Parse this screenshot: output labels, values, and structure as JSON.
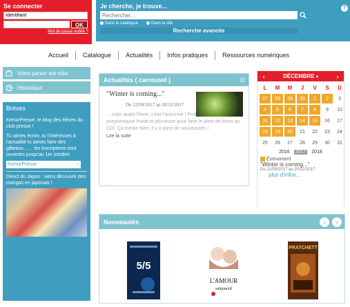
{
  "login": {
    "title": "Se connecter",
    "username_value": "Identifiant",
    "password_value": "",
    "ok_label": "OK",
    "forgot_label": "Mot de passe oublié ?"
  },
  "search": {
    "title": "Je cherche, je trouve...",
    "placeholder": "Rechercher...",
    "radio_catalogue": "Dans le catalogue",
    "radio_site": "Dans le site",
    "advanced_label": "Recherche avancée",
    "help_label": "?"
  },
  "nav": {
    "items": [
      "Accueil",
      "Catalogue",
      "Actualités",
      "Infos pratiques",
      "Ressources numériques"
    ]
  },
  "sidebar": {
    "cart_label": "Votre panier est vide.",
    "history_label": "Historique"
  },
  "breves": {
    "title": "Brèves",
    "p1": "Kerva'Presse, le blog des élèves du club presse !",
    "p2": "Tu aimes écrire, tu t'intéresses à l'actualité tu aimes faire des gâteaux... ... les inscriptions sont ouvertes jusqu'au 1er octobre",
    "button_label": "Kerva'Presse",
    "p3": "Direct du Japon : viens découvrir des mangas en japonais !"
  },
  "actualites": {
    "title": "Actualités ( carrousel )",
    "article_title": "\"Winter is coming...\"",
    "date_text": "Du 22/09/2017 au 20/12/2017",
    "excerpt": "... mais avant l'hiver, c'est l'automne ! Profite de la météo aveyronnaise froide et pluvieuse pour faire le plein de livres au CDI. Ça tombe bien, il y a plein de nouveautés !",
    "more_label": "Lire la suite"
  },
  "calendar": {
    "month": "DÉCEMBRE",
    "weekdays": [
      "L",
      "M",
      "M",
      "J",
      "V",
      "S",
      "D"
    ],
    "days": [
      "27",
      "28",
      "29",
      "30",
      "1",
      "2",
      "3",
      "4",
      "5",
      "6",
      "7",
      "8",
      "9",
      "10",
      "11",
      "12",
      "13",
      "14",
      "15",
      "16",
      "17",
      "18",
      "19",
      "20",
      "21",
      "22",
      "23",
      "24",
      "25",
      "26",
      "27",
      "28",
      "29",
      "30",
      "31"
    ],
    "event_days": [
      "27",
      "28",
      "29",
      "30",
      "1",
      "2",
      "4",
      "5",
      "6",
      "7",
      "8",
      "11",
      "12",
      "13",
      "14",
      "15",
      "18",
      "19",
      "20"
    ],
    "years": [
      "2016",
      "2017",
      "2018"
    ],
    "current_year": "2017",
    "legend_label": "Événement",
    "event_title": "\"Winter is coming...\"",
    "event_dates": "Du 22/09/2017 au 20/12/2017",
    "more_label": "plus d'infos..."
  },
  "nouveautes": {
    "title": "Nouveautés"
  },
  "colors": {
    "red": "#e41e2b",
    "blue": "#3f9ec0",
    "light_blue": "#7fc3cf",
    "orange": "#f0a82a"
  }
}
